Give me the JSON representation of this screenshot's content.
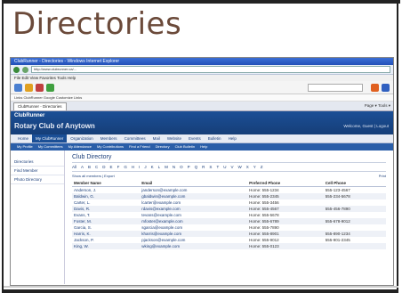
{
  "slide": {
    "title": "Directories"
  },
  "browser": {
    "window_title": "ClubRunner - Directories - Windows Internet Explorer",
    "address": "http://www.clubrunner.ca/...",
    "menu": "File  Edit  View  Favorites  Tools  Help",
    "links": "Links  ClubRunner  Google  Customize Links",
    "tab_label": "ClubRunner - Directories",
    "tab_tools": "Page ▾  Tools ▾"
  },
  "site": {
    "brand": "ClubRunner",
    "club_name": "Rotary Club of Anytown",
    "welcome": "Welcome, Guest  |  Logout",
    "nav": [
      "Home",
      "My ClubRunner",
      "Organization",
      "Members",
      "Committees",
      "Mail",
      "Website",
      "Events",
      "Bulletin",
      "Help"
    ],
    "subnav": [
      "My Profile",
      "My Committees",
      "My Attendance",
      "My Contributions",
      "Find a Friend",
      "Directory",
      "Club Bulletin",
      "Help"
    ],
    "side": [
      "Directories",
      "Find Member",
      "Photo Directory"
    ],
    "main_title": "Club Directory",
    "alphabet": [
      "All",
      "A",
      "B",
      "C",
      "D",
      "E",
      "F",
      "G",
      "H",
      "I",
      "J",
      "K",
      "L",
      "M",
      "N",
      "O",
      "P",
      "Q",
      "R",
      "S",
      "T",
      "U",
      "V",
      "W",
      "X",
      "Y",
      "Z"
    ],
    "options_left": "Show all members  |  Export",
    "options_right": "Print",
    "columns": [
      "Member Name",
      "Email",
      "Preferred Phone",
      "Cell Phone"
    ],
    "rows": [
      [
        "Anderson, J.",
        "janderson@example.com",
        "Home: 555-1234",
        "555-123-4567"
      ],
      [
        "Baldwin, G.",
        "gbaldwin@example.com",
        "Home: 555-2345",
        "555-234-5678"
      ],
      [
        "Carter, L.",
        "lcarter@example.com",
        "Home: 555-3456",
        ""
      ],
      [
        "Davis, R.",
        "rdavis@example.com",
        "Home: 555-4567",
        "555-456-7890"
      ],
      [
        "Evans, T.",
        "tevans@example.com",
        "Home: 555-5678",
        ""
      ],
      [
        "Foster, M.",
        "mfoster@example.com",
        "Home: 555-6789",
        "555-678-9012"
      ],
      [
        "Garcia, S.",
        "sgarcia@example.com",
        "Home: 555-7890",
        ""
      ],
      [
        "Harris, K.",
        "kharris@example.com",
        "Home: 555-8901",
        "555-890-1234"
      ],
      [
        "Jackson, P.",
        "pjackson@example.com",
        "Home: 555-9012",
        "555-901-2345"
      ],
      [
        "King, W.",
        "wking@example.com",
        "Home: 555-0123",
        ""
      ]
    ]
  },
  "colors": {
    "title_brown": "#6b4a3a",
    "site_blue": "#1b4f96"
  }
}
